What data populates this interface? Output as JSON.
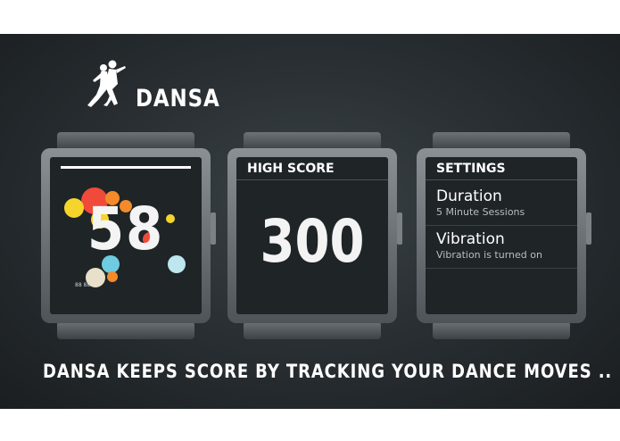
{
  "app": {
    "brand": "DANSA"
  },
  "watches": {
    "score": {
      "value": "58",
      "tiny_label": "88 88"
    },
    "high_score": {
      "title": "HIGH SCORE",
      "value": "300"
    },
    "settings": {
      "title": "SETTINGS",
      "items": [
        {
          "label": "Duration",
          "sub": "5 Minute Sessions"
        },
        {
          "label": "Vibration",
          "sub": "Vibration is turned on"
        }
      ]
    }
  },
  "caption": "DANSA KEEPS SCORE BY TRACKING YOUR DANCE MOVES ..",
  "colors": {
    "accent": "#ffffff",
    "bubble_red": "#f04a3a",
    "bubble_yellow": "#f5d52c",
    "bubble_orange": "#f58a2a",
    "bubble_blue": "#6fcbe0"
  },
  "icons": {
    "logo": "dancing-couple-icon"
  }
}
